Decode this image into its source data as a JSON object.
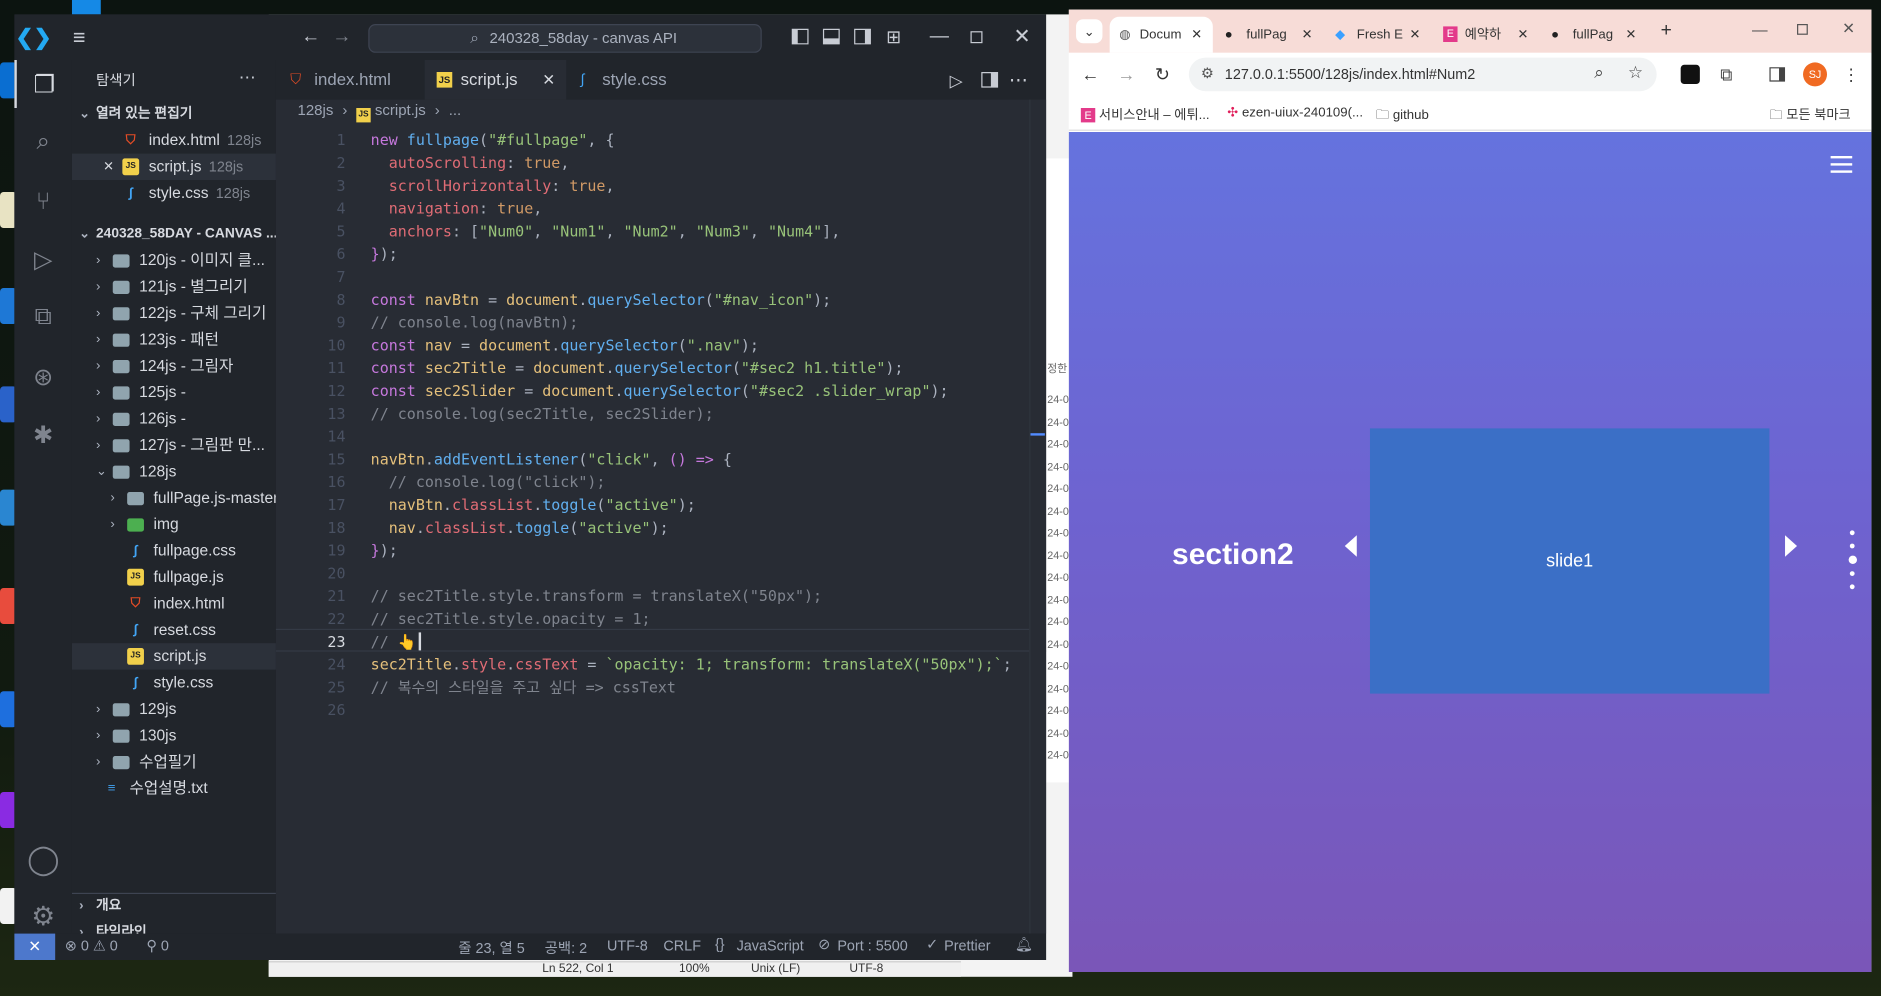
{
  "vscode": {
    "search_text": "240328_58day - canvas API",
    "explorer_title": "탐색기",
    "open_editors_title": "열려 있는 편집기",
    "open_editors": [
      {
        "name": "index.html",
        "folder": "128js"
      },
      {
        "name": "script.js",
        "folder": "128js"
      },
      {
        "name": "style.css",
        "folder": "128js"
      }
    ],
    "workspace_title": "240328_58DAY - CANVAS ...",
    "tree": [
      "120js - 이미지 클...",
      "121js - 별그리기",
      "122js - 구체 그리기",
      "123js - 패턴",
      "124js - 그림자",
      "125js -",
      "126js -",
      "127js - 그림판 만...",
      "128js",
      "fullPage.js-master",
      "img",
      "fullpage.css",
      "fullpage.js",
      "index.html",
      "reset.css",
      "script.js",
      "style.css",
      "129js",
      "130js",
      "수업필기",
      "수업설명.txt"
    ],
    "outline_title": "개요",
    "timeline_title": "타임라인",
    "tabs": [
      "index.html",
      "script.js",
      "style.css"
    ],
    "breadcrumb_folder": "128js",
    "breadcrumb_file": "script.js",
    "breadcrumb_more": "...",
    "line_numbers": [
      "1",
      "2",
      "3",
      "4",
      "5",
      "6",
      "7",
      "8",
      "9",
      "10",
      "11",
      "12",
      "13",
      "14",
      "15",
      "16",
      "17",
      "18",
      "19",
      "20",
      "21",
      "22",
      "23",
      "24",
      "25",
      "26"
    ],
    "status": {
      "errors": "0",
      "warnings": "0",
      "ports": "0",
      "position": "줄 23, 열 5",
      "spaces": "공백: 2",
      "encoding": "UTF-8",
      "eol": "CRLF",
      "language": "JavaScript",
      "port": "Port : 5500",
      "formatter": "Prettier"
    }
  },
  "notepad": {
    "status_pos": "Ln 522, Col 1",
    "status_zoom": "100%",
    "status_eol": "Unix (LF)",
    "status_enc": "UTF-8",
    "side_header": "정한",
    "side_rows": [
      "24-0",
      "24-0",
      "24-0",
      "24-0",
      "24-0",
      "24-0",
      "24-0",
      "24-0",
      "24-0",
      "24-0",
      "24-0",
      "24-0",
      "24-0",
      "24-0",
      "24-0",
      "24-0",
      "24-0"
    ]
  },
  "chrome": {
    "tabs": [
      "Docum",
      "fullPag",
      "Fresh E",
      "예약하",
      "fullPag"
    ],
    "url": "127.0.0.1:5500/128js/index.html#Num2",
    "bookmarks": [
      "서비스안내 – 에튀...",
      "ezen-uiux-240109(...",
      "github"
    ],
    "all_bookmarks": "모든 북마크",
    "profile": "SJ",
    "page": {
      "section_title": "section2",
      "slide_label": "slide1",
      "slide_color": "#3b6fc6"
    }
  }
}
